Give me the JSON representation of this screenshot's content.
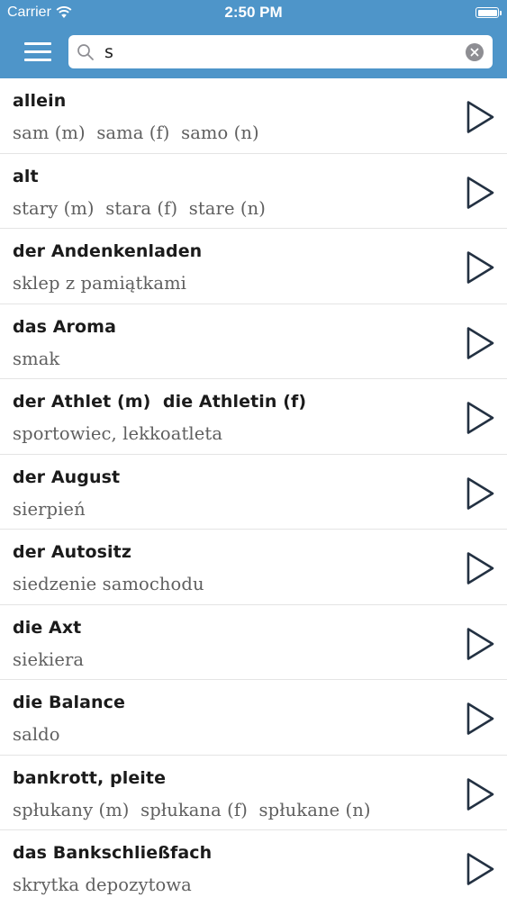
{
  "status_bar": {
    "carrier": "Carrier",
    "time": "2:50 PM"
  },
  "search": {
    "value": "s"
  },
  "colors": {
    "nav_background": "#4e95c9",
    "word_text": "#1b1b1b",
    "translation_text": "#5f5f5f",
    "play_icon": "#233142"
  },
  "entries": [
    {
      "word": "allein",
      "translation": "sam (m)  sama (f)  samo (n)"
    },
    {
      "word": "alt",
      "translation": "stary (m)  stara (f)  stare (n)"
    },
    {
      "word": "der Andenkenladen",
      "translation": "sklep z pamiątkami"
    },
    {
      "word": "das Aroma",
      "translation": "smak"
    },
    {
      "word": "der Athlet (m)  die Athletin (f)",
      "translation": "sportowiec, lekkoatleta"
    },
    {
      "word": "der August",
      "translation": "sierpień"
    },
    {
      "word": "der Autositz",
      "translation": "siedzenie samochodu"
    },
    {
      "word": "die Axt",
      "translation": "siekiera"
    },
    {
      "word": "die Balance",
      "translation": "saldo"
    },
    {
      "word": "bankrott, pleite",
      "translation": "spłukany (m)  spłukana (f)  spłukane (n)"
    },
    {
      "word": "das Bankschließfach",
      "translation": "skrytka depozytowa"
    }
  ]
}
